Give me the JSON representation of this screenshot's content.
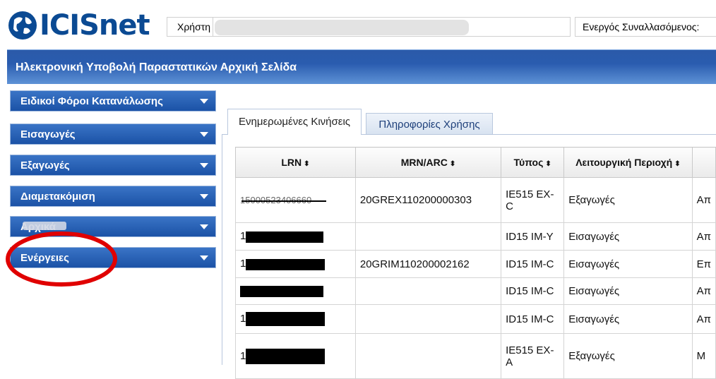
{
  "brand": {
    "name": "ICISnet"
  },
  "user": {
    "label": "Χρήστη",
    "value": ""
  },
  "active_trader": {
    "label": "Ενεργός Συναλλασόμενος:"
  },
  "title": "Ηλεκτρονική Υποβολή Παραστατικών Αρχική Σελίδα",
  "sidebar": {
    "items": [
      {
        "label": "Ειδικοί Φόροι Κατανάλωσης"
      },
      {
        "label": "Εισαγωγές"
      },
      {
        "label": "Εξαγωγές"
      },
      {
        "label": "Διαμετακόμιση"
      },
      {
        "label": "Αρχικά"
      },
      {
        "label": "Ενέργειες"
      }
    ]
  },
  "tabs": [
    {
      "label": "Ενημερωμένες Κινήσεις",
      "active": true
    },
    {
      "label": "Πληροφορίες Χρήσης",
      "active": false
    }
  ],
  "table": {
    "headers": [
      "LRN",
      "MRN/ARC",
      "Τύπος",
      "Λειτουργική Περιοχή",
      ""
    ],
    "sort_icon": "⬍",
    "rows": [
      {
        "lrn": "15000523406660",
        "mrn": "20GREX110200000303",
        "type": "IE515 EX-C",
        "area": "Εξαγωγές",
        "extra": "Απ"
      },
      {
        "lrn": "1",
        "mrn": "",
        "type": "ID15 IM-Y",
        "area": "Εισαγωγές",
        "extra": "Απ"
      },
      {
        "lrn": "1",
        "mrn": "20GRIM110200002162",
        "type": "ID15 IM-C",
        "area": "Εισαγωγές",
        "extra": "Επ"
      },
      {
        "lrn": "",
        "mrn": "",
        "type": "ID15 IM-C",
        "area": "Εισαγωγές",
        "extra": "Απ"
      },
      {
        "lrn": "1",
        "mrn": "",
        "type": "ID15 IM-C",
        "area": "Εισαγωγές",
        "extra": "Απ"
      },
      {
        "lrn": "1",
        "mrn": "",
        "type": "IE515 EX-A",
        "area": "Εξαγωγές",
        "extra": "Μ"
      }
    ]
  },
  "colors": {
    "accent": "#1b52a6",
    "highlight_ring": "#e00000"
  }
}
